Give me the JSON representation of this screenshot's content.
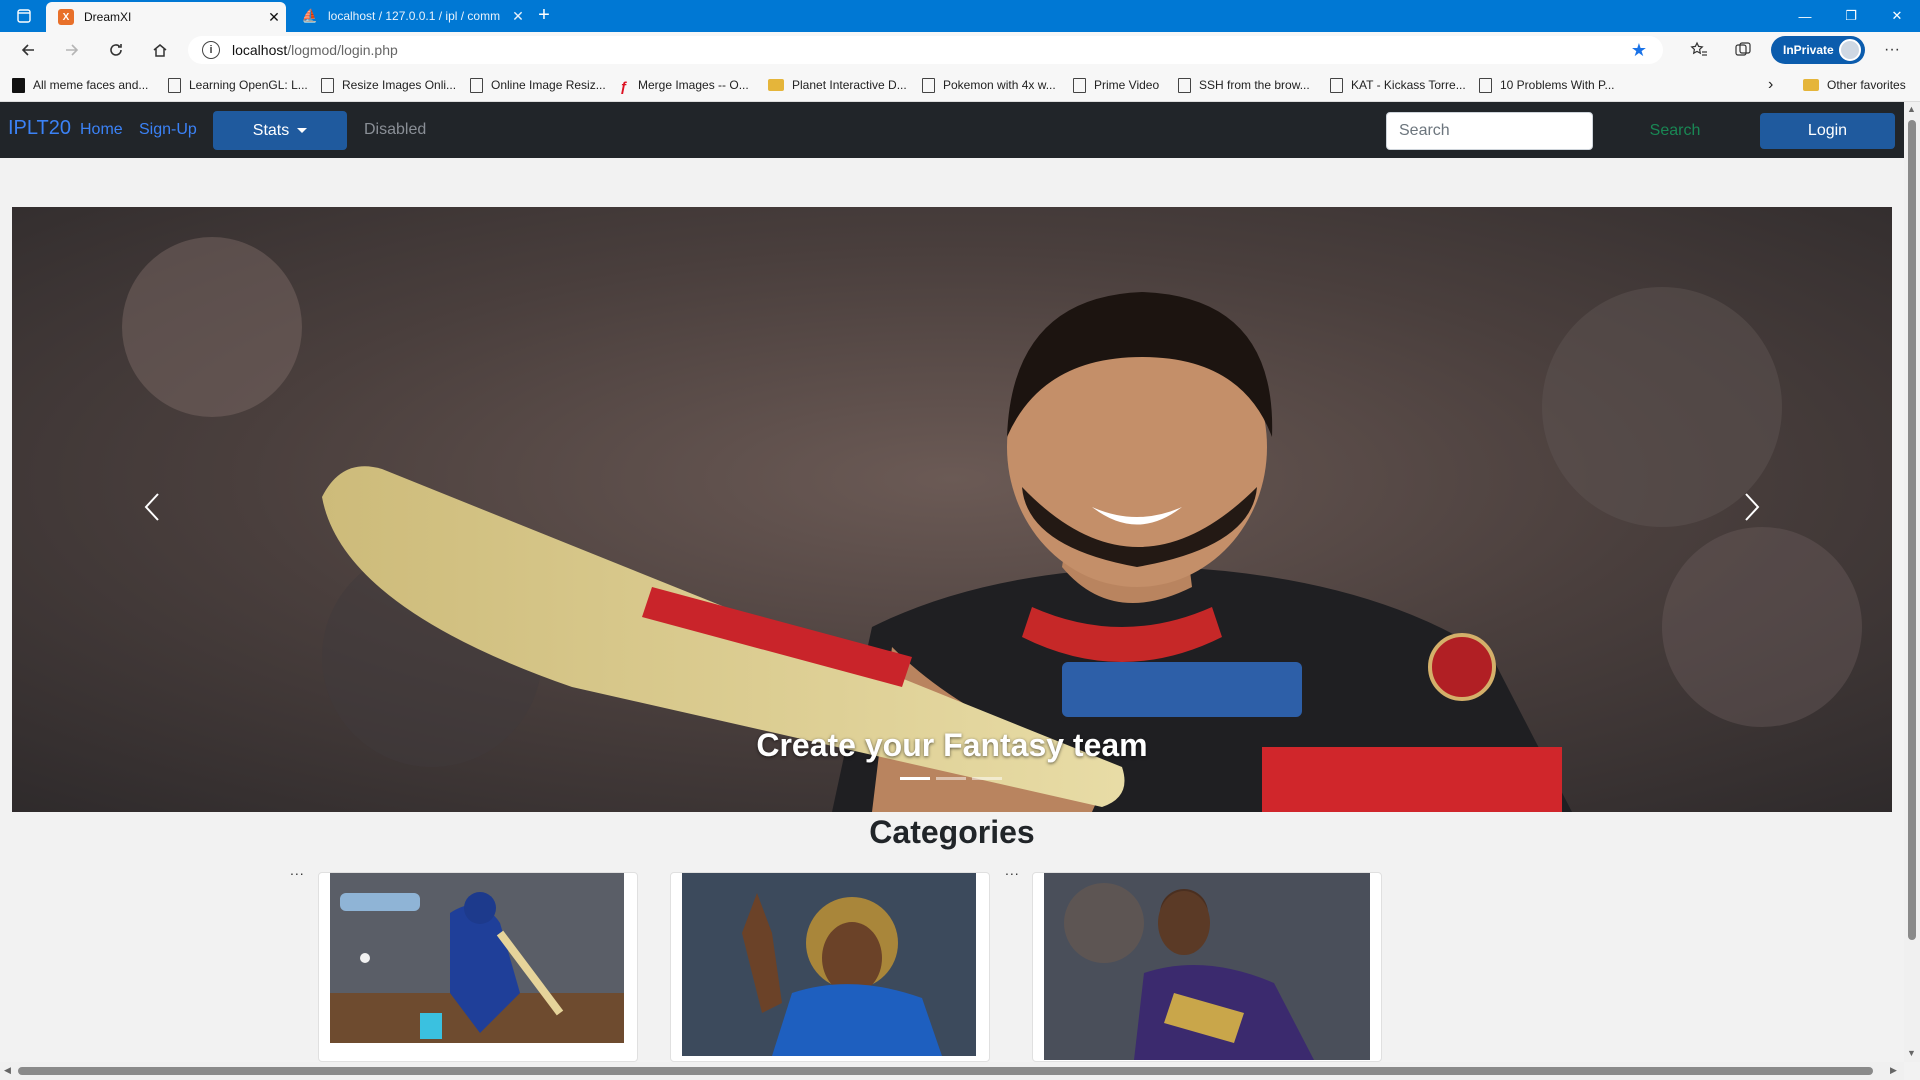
{
  "browser": {
    "tabs": [
      {
        "title": "DreamXI",
        "active": true
      },
      {
        "title": "localhost / 127.0.0.1 / ipl / comm",
        "active": false
      }
    ],
    "url_host": "localhost",
    "url_path": "/logmod/login.php",
    "inprivate_label": "InPrivate",
    "bookmarks": [
      "All meme faces and...",
      "Learning OpenGL: L...",
      "Resize Images Onli...",
      "Online Image Resiz...",
      "Merge Images -- O...",
      "Planet Interactive D...",
      "Pokemon with 4x w...",
      "Prime Video",
      "SSH from the brow...",
      "KAT - Kickass Torre...",
      "10 Problems With P..."
    ],
    "other_favorites": "Other favorites"
  },
  "navbar": {
    "brand": "IPLT20",
    "home": "Home",
    "signup": "Sign-Up",
    "stats": "Stats",
    "disabled": "Disabled",
    "search_placeholder": "Search",
    "search_button": "Search",
    "login": "Login"
  },
  "carousel": {
    "caption": "Create your Fantasy team",
    "indicator_count": 3,
    "active_index": 0
  },
  "categories": {
    "title": "Categories",
    "dots": "..."
  },
  "colors": {
    "browser_accent": "#0078d4",
    "navbar_bg": "#212529",
    "link_blue": "#3b82f6",
    "button_blue": "#1f5a9e",
    "search_green": "#198754"
  }
}
